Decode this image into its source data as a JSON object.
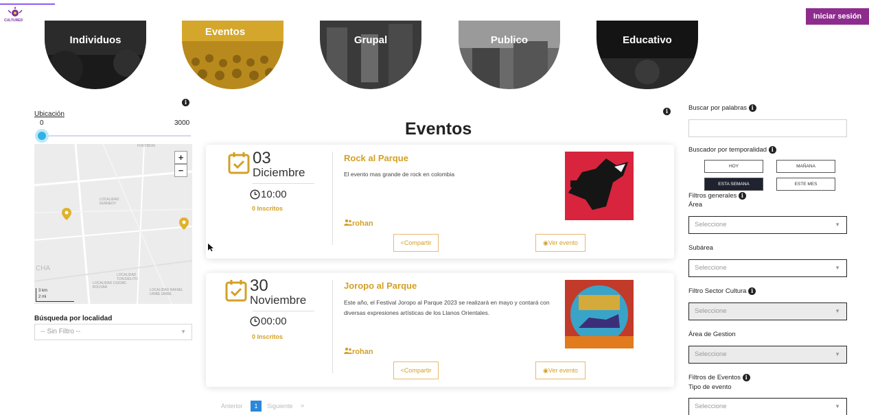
{
  "header": {
    "logo_text": "CULTURED",
    "login_label": "Iniciar sesión"
  },
  "categories": [
    {
      "label": "Individuos",
      "color": "#1a1a1a"
    },
    {
      "label": "Eventos",
      "color": "#d4a72c"
    },
    {
      "label": "Grupal",
      "color": "#2a2a2a"
    },
    {
      "label": "Publico",
      "color": "#555555"
    },
    {
      "label": "Educativo",
      "color": "#141414"
    }
  ],
  "left": {
    "location_label": "Ubicación",
    "range_min": "0",
    "range_max": "3000",
    "slider_value": 0,
    "map_zoom_in": "+",
    "map_zoom_out": "−",
    "map_scale_km": "3 km",
    "map_scale_mi": "2 mi",
    "map_labels": [
      "FONTIBÓN",
      "LOCALIDAD KENNEDY",
      "LOCALIDAD TUNJUELITO",
      "LOCALIDAD CIUDAD BOLÍVAR",
      "LOCALIDAD RAFAEL URIBE URIBE",
      "CHA"
    ],
    "locality_label": "Búsqueda por localidad",
    "locality_select": "-- Sin Filtro --"
  },
  "main": {
    "title": "Eventos",
    "events": [
      {
        "day": "03",
        "month": "Diciembre",
        "time": "10:00",
        "inscritos": "0 Inscritos",
        "title": "Rock al Parque",
        "description": "El evento mas grande de rock en colombia",
        "author": "rohan",
        "share_label": "Compartir",
        "view_label": "Ver evento"
      },
      {
        "day": "30",
        "month": "Noviembre",
        "time": "00:00",
        "inscritos": "0 Inscritos",
        "title": "Joropo al Parque",
        "description": "Este año, el Festival Joropo al Parque 2023 se realizará en mayo y contará con diversas expresiones artísticas de los Llanos Orientales.",
        "author": "rohan",
        "share_label": "Compartir",
        "view_label": "Ver evento"
      }
    ],
    "pagination": {
      "prev": "Anterior",
      "current": "1",
      "next": "Siguiente",
      "next_arrow": "»"
    }
  },
  "right": {
    "search_label": "Buscar por palabras",
    "search_value": "",
    "temporal_label": "Buscador por temporalidad",
    "temporal_options": [
      "HOY",
      "MAÑANA",
      "ESTA SEMANA",
      "ESTE MES"
    ],
    "temporal_active": "ESTA SEMANA",
    "general_filters_label": "Filtros generales",
    "area_label": "Área",
    "area_select": "Seleccione",
    "subarea_label": "Subárea",
    "subarea_select": "Seleccione",
    "sector_label": "Filtro Sector Cultura",
    "sector_select": "Seleccione",
    "gestion_label": "Área de Gestion",
    "gestion_select": "Seleccione",
    "event_filters_label": "Filtros de Eventos",
    "event_type_label": "Tipo de evento",
    "event_type_select": "Seleccione"
  }
}
